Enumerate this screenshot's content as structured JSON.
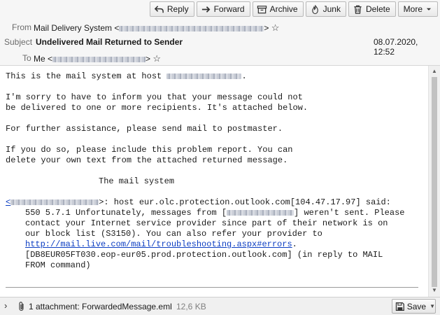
{
  "toolbar": {
    "reply": "Reply",
    "forward": "Forward",
    "archive": "Archive",
    "junk": "Junk",
    "delete": "Delete",
    "more": "More"
  },
  "header": {
    "from_label": "From",
    "from_name": "Mail Delivery System <",
    "from_close": ">",
    "subject_label": "Subject",
    "subject": "Undelivered Mail Returned to Sender",
    "date": "08.07.2020, 12:52",
    "to_label": "To",
    "to_name": "Me <",
    "to_close": ">"
  },
  "message": {
    "l1": "This is the mail system at host",
    "l1_end": ".",
    "l2": "I'm sorry to have to inform you that your message could not",
    "l3": "be delivered to one or more recipients. It's attached below.",
    "l4": "For further assistance, please send mail to postmaster.",
    "l5": "If you do so, please include this problem report. You can",
    "l6": "delete your own text from the attached returned message.",
    "l7": "The mail system",
    "l8_open": "<",
    "l8": ">: host eur.olc.protection.outlook.com[104.47.17.97] said:",
    "l9a": "550 5.7.1 Unfortunately, messages from [",
    "l9b": "] weren't sent. Please",
    "l10": "contact your Internet service provider since part of their network is on",
    "l11": "our block list (S3150). You can also refer your provider to",
    "link": "http://mail.live.com/mail/troubleshooting.aspx#errors",
    "l12_end": ".",
    "l13": "[DB8EUR05FT030.eop-eur05.prod.protection.outlook.com] (in reply to MAIL",
    "l14": "FROM command)"
  },
  "attachment": {
    "label": "1 attachment: ForwardedMessage.eml",
    "size": "12,6 KB",
    "save": "Save"
  }
}
